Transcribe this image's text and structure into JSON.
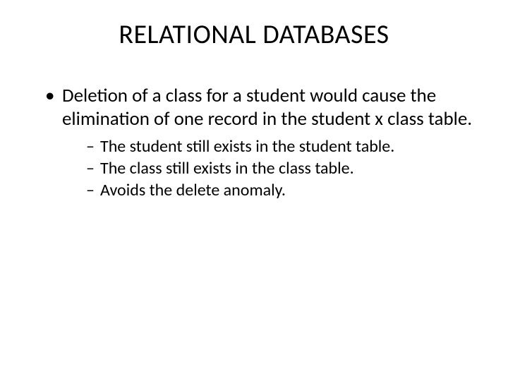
{
  "title": "RELATIONAL DATABASES",
  "bullets": {
    "main": "Deletion of a class for a student would cause the elimination of one record in the student x class table.",
    "subs": [
      "The student still exists in the student table.",
      "The class still exists in the class table.",
      "Avoids the delete anomaly."
    ]
  }
}
